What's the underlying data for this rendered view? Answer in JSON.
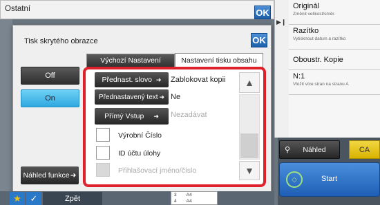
{
  "top": {
    "title": "Ostatní",
    "ok": "OK"
  },
  "dialog": {
    "title": "Tisk skrytého obrazce",
    "ok": "OK"
  },
  "tabs": [
    {
      "label": "Výchozí Nastavení"
    },
    {
      "label": "Nastavení tisku obsahu"
    }
  ],
  "toggle": {
    "off": "Off",
    "on": "On",
    "selected": "On"
  },
  "settings": [
    {
      "button": "Přednast. slovo",
      "value": "Zablokovat kopii"
    },
    {
      "button": "Přednastavený text",
      "value": "Ne"
    },
    {
      "button": "Přímý Vstup",
      "value": "Nezadávat"
    }
  ],
  "checks": [
    {
      "label": "Výrobní Číslo",
      "enabled": true
    },
    {
      "label": "ID účtu úlohy",
      "enabled": true
    },
    {
      "label": "Přihlašovací jméno/číslo",
      "enabled": false
    }
  ],
  "preview_button": "Náhled funkce",
  "right_panel": {
    "items": [
      {
        "title": "Originál",
        "sub": "Změnit velikost/směr."
      },
      {
        "title": "Razítko",
        "sub": "Vytisknout datum a razítko"
      },
      {
        "title": "Oboustr. Kopie",
        "sub": ""
      },
      {
        "title": "N:1",
        "sub": "Vložit více stran na stranu A"
      }
    ],
    "preview": "Náhled",
    "ca": "CA",
    "start": "Start"
  },
  "bottom": {
    "back": "Zpět",
    "tray_rows": [
      {
        "num": "3",
        "size": "A4"
      },
      {
        "num": "4",
        "size": "A4"
      }
    ]
  },
  "colors": {
    "accent_blue": "#1b5faa",
    "highlight": "#e0202a",
    "on_cyan": "#35b8ec",
    "ca_yellow": "#e6c51a",
    "start_blue": "#2b6fc4"
  }
}
